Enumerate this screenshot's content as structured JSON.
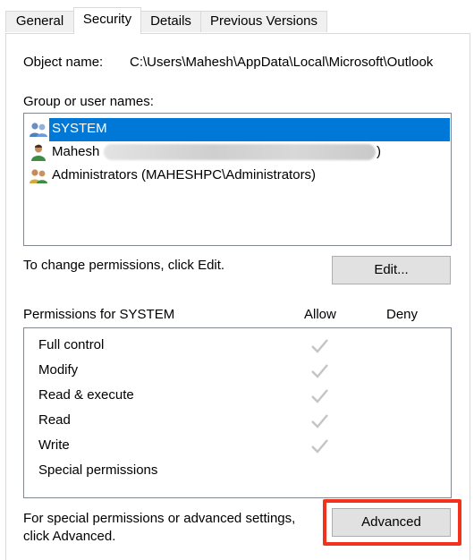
{
  "tabs": [
    {
      "label": "General",
      "active": false
    },
    {
      "label": "Security",
      "active": true
    },
    {
      "label": "Details",
      "active": false
    },
    {
      "label": "Previous Versions",
      "active": false
    }
  ],
  "object": {
    "label": "Object name:",
    "value": "C:\\Users\\Mahesh\\AppData\\Local\\Microsoft\\Outlook"
  },
  "groups": {
    "label": "Group or user names:",
    "items": [
      {
        "name": "SYSTEM",
        "icon": "users-group-icon",
        "selected": true
      },
      {
        "name": "Mahesh",
        "suffix": ")",
        "icon": "user-icon",
        "selected": false
      },
      {
        "name": "Administrators (MAHESHPC\\Administrators)",
        "icon": "users-group-icon",
        "selected": false
      }
    ]
  },
  "change": {
    "text": "To change permissions, click Edit.",
    "edit_label": "Edit..."
  },
  "permissions": {
    "header": "Permissions for SYSTEM",
    "allow_label": "Allow",
    "deny_label": "Deny",
    "rows": [
      {
        "name": "Full control",
        "allow": true,
        "deny": false
      },
      {
        "name": "Modify",
        "allow": true,
        "deny": false
      },
      {
        "name": "Read & execute",
        "allow": true,
        "deny": false
      },
      {
        "name": "Read",
        "allow": true,
        "deny": false
      },
      {
        "name": "Write",
        "allow": true,
        "deny": false
      },
      {
        "name": "Special permissions",
        "allow": false,
        "deny": false
      }
    ]
  },
  "advanced": {
    "text_line1": "For special permissions or advanced settings,",
    "text_line2": "click Advanced.",
    "button_label": "Advanced"
  },
  "colors": {
    "selection": "#0078d7",
    "highlight_box": "#f2321b",
    "check": "#c4c4c4"
  }
}
